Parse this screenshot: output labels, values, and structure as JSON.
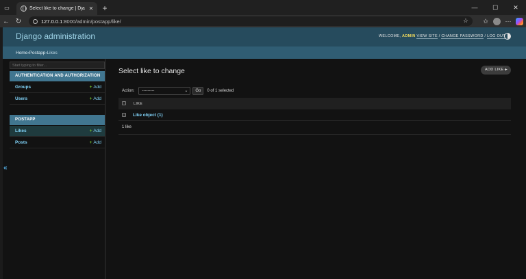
{
  "browser": {
    "tab_title": "Select like to change | Django site admin",
    "url_host": "127.0.0.1",
    "url_rest": ":8000/admin/postapp/like/"
  },
  "header": {
    "brand": "Django administration",
    "welcome": "WELCOME,",
    "username": "ADMIN",
    "view_site": "VIEW SITE",
    "change_password": "CHANGE PASSWORD",
    "log_out": "LOG OUT",
    "separator": " / "
  },
  "breadcrumbs": [
    "Home",
    "Postapp",
    "Likes"
  ],
  "breadcrumb_sep": " › ",
  "sidebar": {
    "filter_placeholder": "Start typing to filter...",
    "modules": [
      {
        "caption": "AUTHENTICATION AND AUTHORIZATION",
        "models": [
          {
            "name": "Groups",
            "add": "Add"
          },
          {
            "name": "Users",
            "add": "Add"
          }
        ]
      },
      {
        "caption": "POSTAPP",
        "models": [
          {
            "name": "Likes",
            "add": "Add",
            "selected": true
          },
          {
            "name": "Posts",
            "add": "Add"
          }
        ]
      }
    ],
    "collapse_glyph": "«"
  },
  "content": {
    "title": "Select like to change",
    "add_button": "ADD LIKE",
    "action_label": "Action:",
    "action_selected": "---------",
    "go_label": "Go",
    "selection_counter": "0 of 1 selected",
    "column_header": "LIKE",
    "rows": [
      "Like object (1)"
    ],
    "paginator": "1 like"
  },
  "colors": {
    "header_bg": "#264b5d",
    "breadcrumb_bg": "#305d73",
    "module_caption_bg": "#417690",
    "link": "#81d4fa",
    "add_plus": "#70bf2b"
  }
}
